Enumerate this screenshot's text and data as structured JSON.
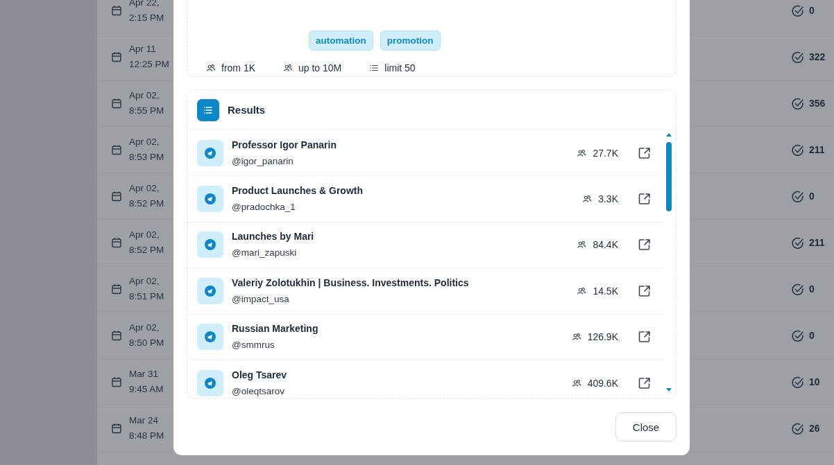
{
  "background_table": {
    "rows": [
      {
        "date": "Apr 22,",
        "time": "2:15 PM",
        "count": "0"
      },
      {
        "date": "Apr 11",
        "time": "12:25 PM",
        "count": "322"
      },
      {
        "date": "Apr 02,",
        "time": "8:55 PM",
        "count": "356"
      },
      {
        "date": "Apr 02,",
        "time": "8:53 PM",
        "count": "211"
      },
      {
        "date": "Apr 02,",
        "time": "8:52 PM",
        "count": "0"
      },
      {
        "date": "Apr 02,",
        "time": "8:52 PM",
        "count": "211"
      },
      {
        "date": "Apr 02,",
        "time": "8:51 PM",
        "count": "0"
      },
      {
        "date": "Apr 02,",
        "time": "8:50 PM",
        "count": "0"
      },
      {
        "date": "Mar 31",
        "time": "9:45 AM",
        "count": "10"
      },
      {
        "date": "Mar 24",
        "time": "8:48 PM",
        "count": "26"
      }
    ]
  },
  "dialog": {
    "tags": [
      "automation",
      "promotion"
    ],
    "filters": [
      {
        "kind": "audience",
        "label": "from 1K"
      },
      {
        "kind": "audience",
        "label": "up to 10M"
      },
      {
        "kind": "limit",
        "label": "limit 50"
      }
    ],
    "results": {
      "title": "Results",
      "items": [
        {
          "name": "Professor Igor Panarin",
          "handle": "@igor_panarin",
          "subscribers": "27.7K"
        },
        {
          "name": "Product Launches & Growth",
          "handle": "@pradochka_1",
          "subscribers": "3.3K"
        },
        {
          "name": "Launches by Mari",
          "handle": "@mari_zapuski",
          "subscribers": "84.4K"
        },
        {
          "name": "Valeriy Zolotukhin | Business. Investments. Politics",
          "handle": "@impact_usa",
          "subscribers": "14.5K"
        },
        {
          "name": "Russian Marketing",
          "handle": "@smmrus",
          "subscribers": "126.9K"
        },
        {
          "name": "Oleg Tsarev",
          "handle": "@oleqtsarov",
          "subscribers": "409.6K"
        }
      ]
    },
    "close_button": "Close"
  }
}
